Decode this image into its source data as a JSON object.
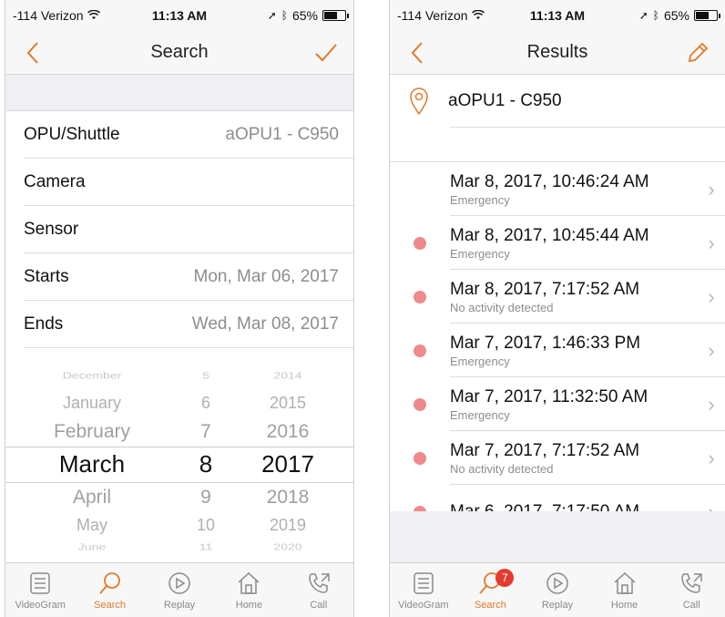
{
  "colors": {
    "accent": "#e07a2a",
    "dot": "#ef8a8a",
    "badge": "#e53b2f"
  },
  "left": {
    "status": {
      "carrier": "-114 Verizon",
      "time": "11:13 AM",
      "battery": "65%",
      "battery_level": 0.65
    },
    "nav": {
      "title": "Search",
      "back_icon": "chevron-left-icon",
      "confirm_icon": "checkmark-icon"
    },
    "form": {
      "opu_label": "OPU/Shuttle",
      "opu_value": "aOPU1 - C950",
      "camera_label": "Camera",
      "sensor_label": "Sensor",
      "starts_label": "Starts",
      "starts_value": "Mon, Mar 06, 2017",
      "ends_label": "Ends",
      "ends_value": "Wed, Mar 08, 2017"
    },
    "picker": {
      "months": [
        "December",
        "January",
        "February",
        "March",
        "April",
        "May",
        "June"
      ],
      "days": [
        "5",
        "6",
        "7",
        "8",
        "9",
        "10",
        "11"
      ],
      "years": [
        "2014",
        "2015",
        "2016",
        "2017",
        "2018",
        "2019",
        "2020"
      ],
      "selected_index": 3
    }
  },
  "right": {
    "status": {
      "carrier": "-114 Verizon",
      "time": "11:13 AM",
      "battery": "65%",
      "battery_level": 0.65
    },
    "nav": {
      "title": "Results",
      "back_icon": "chevron-left-icon",
      "edit_icon": "pencil-icon"
    },
    "location": "aOPU1 - C950",
    "results": [
      {
        "title": "Mar 8, 2017, 10:46:24 AM",
        "subtitle": "Emergency",
        "dot": false
      },
      {
        "title": "Mar 8, 2017, 10:45:44 AM",
        "subtitle": "Emergency",
        "dot": true
      },
      {
        "title": "Mar 8, 2017, 7:17:52 AM",
        "subtitle": "No activity detected",
        "dot": true
      },
      {
        "title": "Mar 7, 2017, 1:46:33 PM",
        "subtitle": "Emergency",
        "dot": true
      },
      {
        "title": "Mar 7, 2017, 11:32:50 AM",
        "subtitle": "Emergency",
        "dot": true
      },
      {
        "title": "Mar 7, 2017, 7:17:52 AM",
        "subtitle": "No activity detected",
        "dot": true
      },
      {
        "title": "Mar 6, 2017, 7:17:50 AM",
        "subtitle": "",
        "dot": true
      }
    ]
  },
  "tabs": {
    "videogram": "VideoGram",
    "search": "Search",
    "replay": "Replay",
    "home": "Home",
    "call": "Call",
    "search_badge": "7"
  }
}
